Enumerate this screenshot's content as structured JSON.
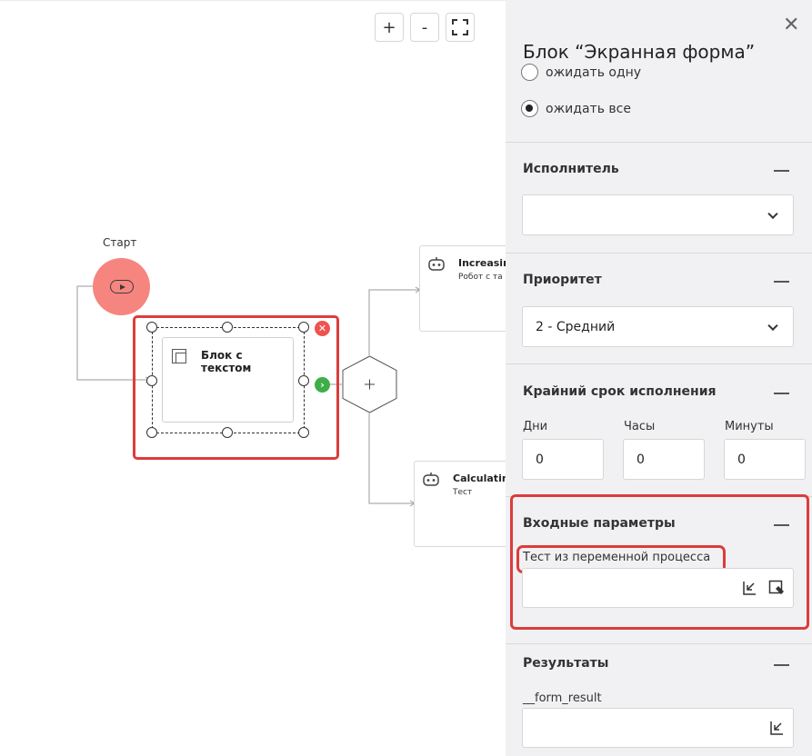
{
  "canvas": {
    "zoom_in_label": "+",
    "zoom_out_label": "-",
    "start_label": "Старт",
    "text_block_label": "Блок с текстом",
    "robot_card_1": {
      "title": "Increasin",
      "subtitle": "Робот с та"
    },
    "robot_card_2": {
      "title": "Calculatin",
      "subtitle": "Тест"
    }
  },
  "panel": {
    "title": "Блок “Экранная форма”",
    "wait_options": [
      {
        "label": "ожидать одну",
        "checked": false
      },
      {
        "label": "ожидать все",
        "checked": true
      }
    ],
    "executor": {
      "title": "Исполнитель",
      "value": ""
    },
    "priority": {
      "title": "Приоритет",
      "value": "2 - Средний"
    },
    "deadline": {
      "title": "Крайний срок исполнения",
      "days_label": "Дни",
      "days_value": "0",
      "hours_label": "Часы",
      "hours_value": "0",
      "minutes_label": "Минуты",
      "minutes_value": "0"
    },
    "inputs": {
      "title": "Входные параметры",
      "param_label": "Тест из переменной процесса",
      "param_value": ""
    },
    "results": {
      "title": "Результаты",
      "param_label": "__form_result",
      "param_value": ""
    }
  },
  "colors": {
    "selection_red": "#dc3c3c",
    "start_node": "#f6857f",
    "ok_green": "#3fae49",
    "panel_bg": "#f1f1f3"
  },
  "icons": [
    "zoom-in-icon",
    "zoom-out-icon",
    "fit-screen-icon",
    "play-icon",
    "text-block-icon",
    "delete-node-icon",
    "next-arrow-icon",
    "plus-icon",
    "robot-icon",
    "close-icon",
    "chevron-down-icon",
    "variable-insert-icon",
    "edit-value-icon"
  ]
}
